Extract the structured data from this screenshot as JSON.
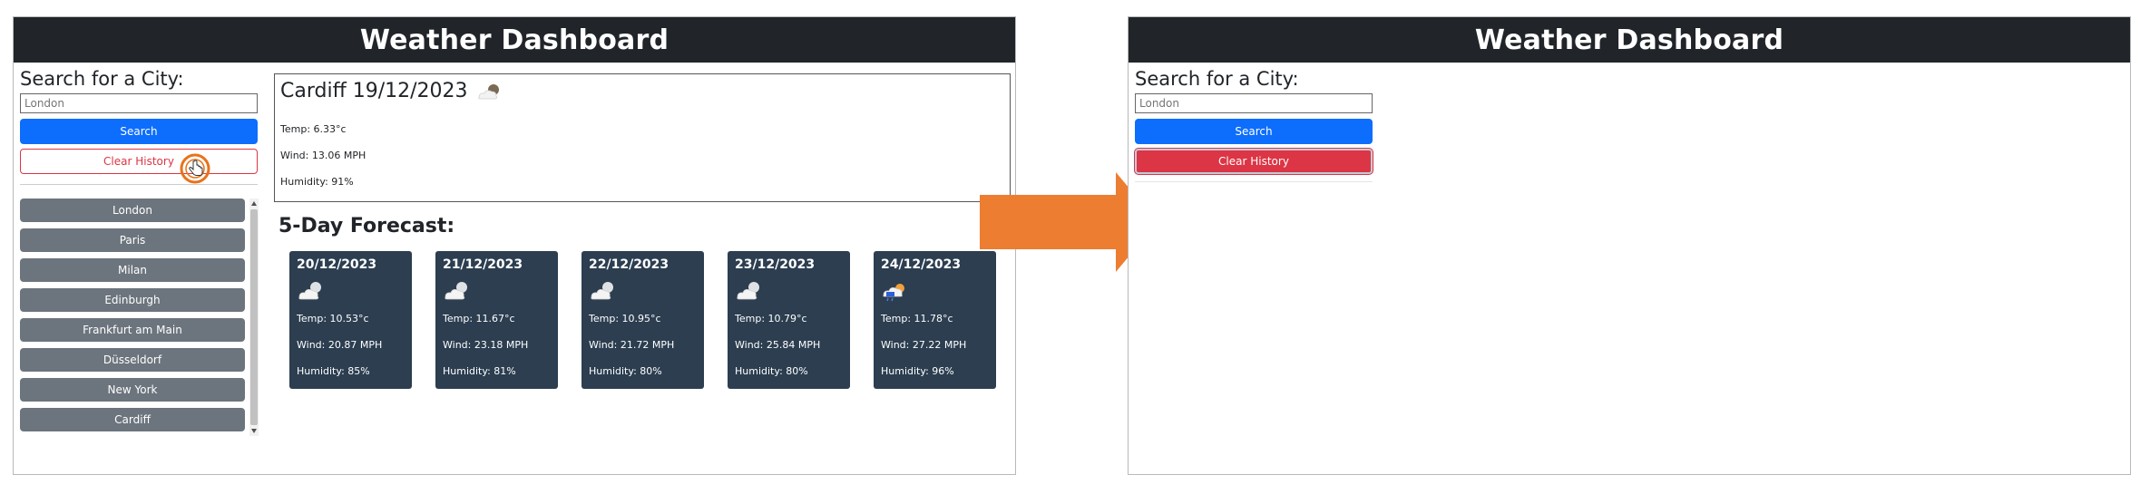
{
  "header_title": "Weather Dashboard",
  "search": {
    "title": "Search for a City:",
    "placeholder": "London",
    "search_label": "Search",
    "clear_label": "Clear History"
  },
  "history": [
    "London",
    "Paris",
    "Milan",
    "Edinburgh",
    "Frankfurt am Main",
    "Düsseldorf",
    "New York",
    "Cardiff"
  ],
  "current": {
    "title": "Cardiff 19/12/2023",
    "icon": "partly-cloudy-icon",
    "temp": "Temp: 6.33°c",
    "wind": "Wind: 13.06 MPH",
    "humidity": "Humidity: 91%"
  },
  "forecast_title": "5-Day Forecast:",
  "forecast": [
    {
      "date": "20/12/2023",
      "icon": "partly-cloudy-icon",
      "temp": "Temp: 10.53°c",
      "wind": "Wind: 20.87 MPH",
      "humidity": "Humidity: 85%"
    },
    {
      "date": "21/12/2023",
      "icon": "partly-cloudy-icon",
      "temp": "Temp: 11.67°c",
      "wind": "Wind: 23.18 MPH",
      "humidity": "Humidity: 81%"
    },
    {
      "date": "22/12/2023",
      "icon": "partly-cloudy-icon",
      "temp": "Temp: 10.95°c",
      "wind": "Wind: 21.72 MPH",
      "humidity": "Humidity: 80%"
    },
    {
      "date": "23/12/2023",
      "icon": "partly-cloudy-icon",
      "temp": "Temp: 10.79°c",
      "wind": "Wind: 25.84 MPH",
      "humidity": "Humidity: 80%"
    },
    {
      "date": "24/12/2023",
      "icon": "rain-sun-icon",
      "temp": "Temp: 11.78°c",
      "wind": "Wind: 27.22 MPH",
      "humidity": "Humidity: 96%"
    }
  ],
  "colors": {
    "header_bg": "#212529",
    "primary": "#0d6efd",
    "danger": "#dc3545",
    "history_btn": "#6c757d",
    "forecast_card": "#2c3e50",
    "arrow": "#ed7d31"
  }
}
